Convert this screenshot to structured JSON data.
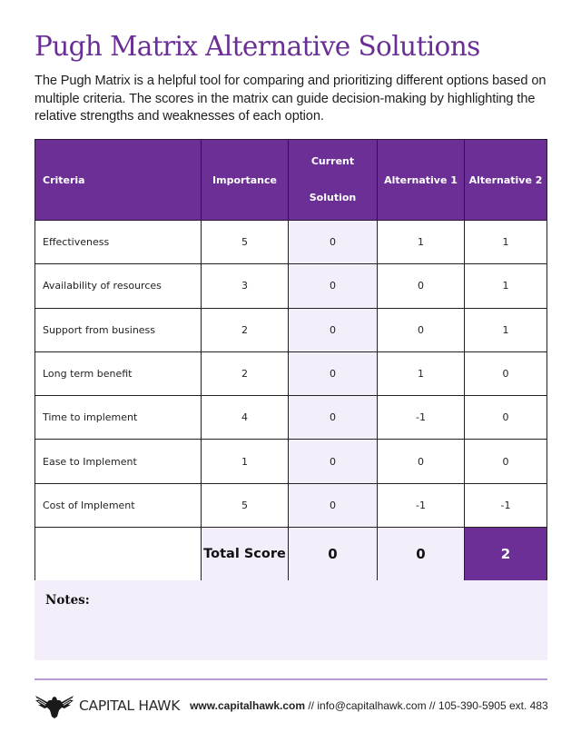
{
  "header": {
    "title": "Pugh Matrix Alternative Solutions",
    "intro": "The Pugh Matrix is a helpful tool for comparing and prioritizing different options based on multiple criteria. The scores in the matrix can guide decision-making by highlighting the relative strengths and weaknesses of each option."
  },
  "matrix": {
    "columns": {
      "criteria": "Criteria",
      "importance": "Importance",
      "current_line1": "Current",
      "current_line2": "Solution",
      "alt1": "Alternative 1",
      "alt2": "Alternative 2"
    },
    "rows": [
      {
        "criteria": "Effectiveness",
        "importance": "5",
        "current": "0",
        "alt1": "1",
        "alt2": "1"
      },
      {
        "criteria": "Availability of resources",
        "importance": "3",
        "current": "0",
        "alt1": "0",
        "alt2": "1"
      },
      {
        "criteria": "Support from business",
        "importance": "2",
        "current": "0",
        "alt1": "0",
        "alt2": "1"
      },
      {
        "criteria": "Long term benefit",
        "importance": "2",
        "current": "0",
        "alt1": "1",
        "alt2": "0"
      },
      {
        "criteria": "Time to implement",
        "importance": "4",
        "current": "0",
        "alt1": "-1",
        "alt2": "0"
      },
      {
        "criteria": "Ease to Implement",
        "importance": "1",
        "current": "0",
        "alt1": "0",
        "alt2": "0"
      },
      {
        "criteria": "Cost of Implement",
        "importance": "5",
        "current": "0",
        "alt1": "-1",
        "alt2": "-1"
      }
    ],
    "total": {
      "label": "Total Score",
      "current": "0",
      "alt1": "0",
      "alt2": "2"
    }
  },
  "notes": {
    "label": "Notes:"
  },
  "footer": {
    "brand": "CAPITAL HAWK",
    "website": "www.capitalhawk.com",
    "contact_rest": " // info@capitalhawk.com // 105-390-5905 ext. 483"
  },
  "colors": {
    "accent": "#6b2f96",
    "title": "#6a2f96",
    "lavender": "#f4eefb",
    "divider": "#b99bd3"
  }
}
